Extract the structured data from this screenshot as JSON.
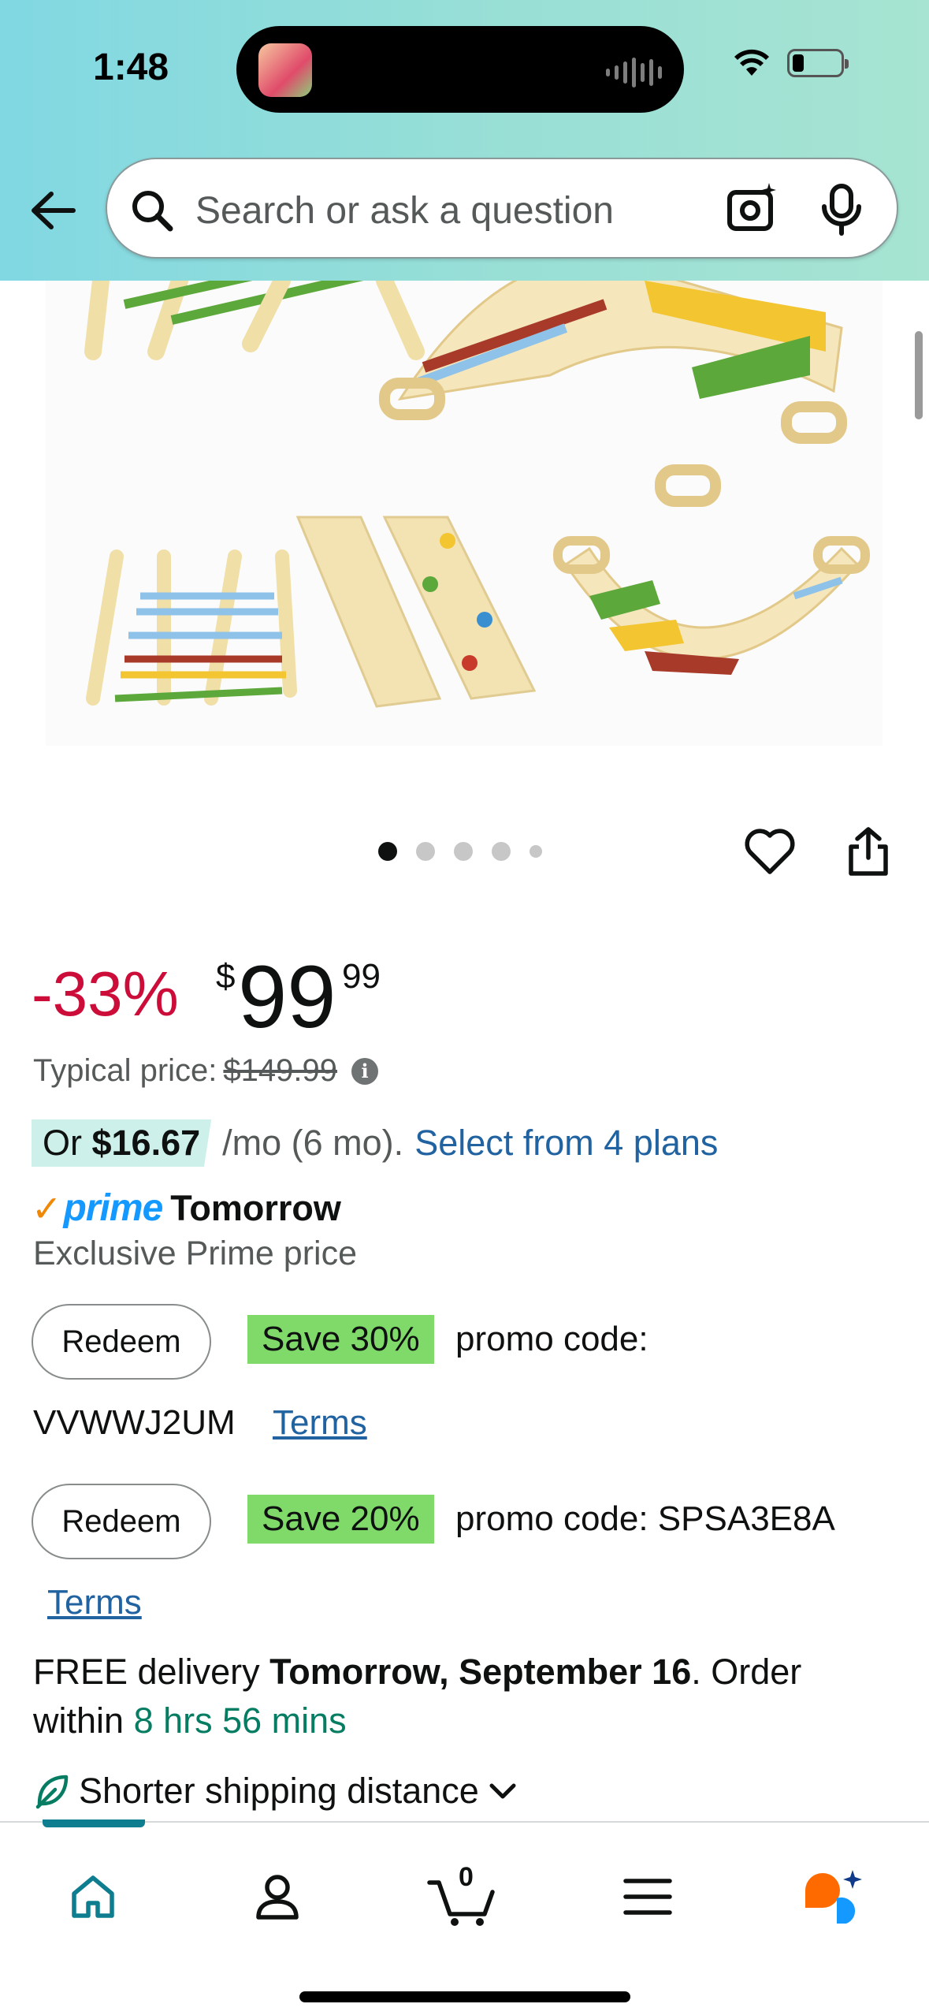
{
  "status_bar": {
    "time": "1:48"
  },
  "search": {
    "placeholder": "Search or ask a question"
  },
  "gallery": {
    "total_images": 5,
    "active_index": 0
  },
  "price": {
    "discount": "-33%",
    "currency_symbol": "$",
    "whole": "99",
    "fraction": "99",
    "typical_label": "Typical price:",
    "typical_value": "$149.99"
  },
  "installment": {
    "prefix": "Or ",
    "amount": "$16.67",
    "period": "/mo (6 mo).",
    "link": "Select from 4 plans"
  },
  "prime": {
    "check": "✓",
    "word": "prime",
    "when": "Tomorrow",
    "subtitle": "Exclusive Prime price"
  },
  "promos": [
    {
      "button": "Redeem",
      "badge": "Save 30%",
      "text": "promo code:",
      "code": "VVWWJ2UM",
      "terms": "Terms"
    },
    {
      "button": "Redeem",
      "badge": "Save 20%",
      "text": "promo code: SPSA3E8A",
      "terms": "Terms"
    }
  ],
  "delivery": {
    "prefix": "FREE delivery ",
    "date": "Tomorrow, September 16",
    "mid": ". Order within ",
    "countdown": "8 hrs 56 mins"
  },
  "shipping": {
    "label": "Shorter shipping distance"
  },
  "bottom_nav": {
    "cart_count": "0"
  },
  "colors": {
    "header_gradient_start": "#81d8e2",
    "header_gradient_end": "#a7e4d2",
    "discount": "#cc0c39",
    "link": "#2162a1",
    "promo_badge": "#7fda69",
    "installment_badge": "#cdf1ea",
    "prime_blue": "#1399ff",
    "prime_check": "#f08804",
    "countdown_green": "#067d62",
    "nav_active": "#0e7d8f"
  }
}
